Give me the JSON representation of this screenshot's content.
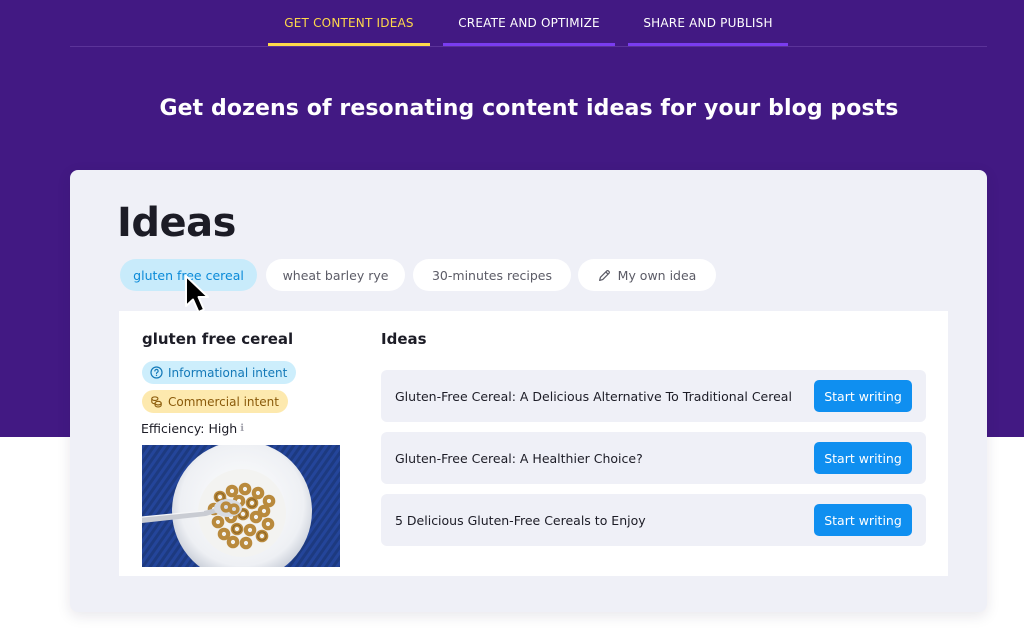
{
  "nav": {
    "tabs": [
      {
        "label": "GET CONTENT IDEAS",
        "active": true
      },
      {
        "label": "CREATE AND OPTIMIZE",
        "active": false
      },
      {
        "label": "SHARE AND PUBLISH",
        "active": false
      }
    ]
  },
  "hero": {
    "title": "Get dozens of resonating content ideas for your blog posts"
  },
  "card": {
    "heading": "Ideas",
    "chips": [
      {
        "label": "gluten free cereal",
        "active": true
      },
      {
        "label": "wheat barley rye",
        "active": false
      },
      {
        "label": "30-minutes recipes",
        "active": false
      },
      {
        "label": "My own idea",
        "icon": "pencil-icon",
        "active": false
      }
    ],
    "topic": {
      "title": "gluten free cereal",
      "badges": [
        {
          "label": "Informational intent",
          "icon": "question-circle-icon"
        },
        {
          "label": "Commercial intent",
          "icon": "coins-icon"
        }
      ],
      "efficiency": "Efficiency: High",
      "efficiency_info_icon": "info-icon",
      "image": "cereal-bowl-photo"
    },
    "ideas": {
      "title": "Ideas",
      "items": [
        {
          "text": "Gluten-Free Cereal: A Delicious Alternative To Traditional Cereal",
          "button": "Start writing"
        },
        {
          "text": "Gluten-Free Cereal: A Healthier Choice?",
          "button": "Start writing"
        },
        {
          "text": "5 Delicious Gluten-Free Cereals to Enjoy",
          "button": "Start writing"
        }
      ]
    }
  },
  "colors": {
    "hero_bg": "#421983",
    "active_tab": "#ffd84a",
    "tab_underline": "#7a3cf0",
    "primary_button": "#0f8ff0",
    "card_bg": "#eff0f7"
  }
}
